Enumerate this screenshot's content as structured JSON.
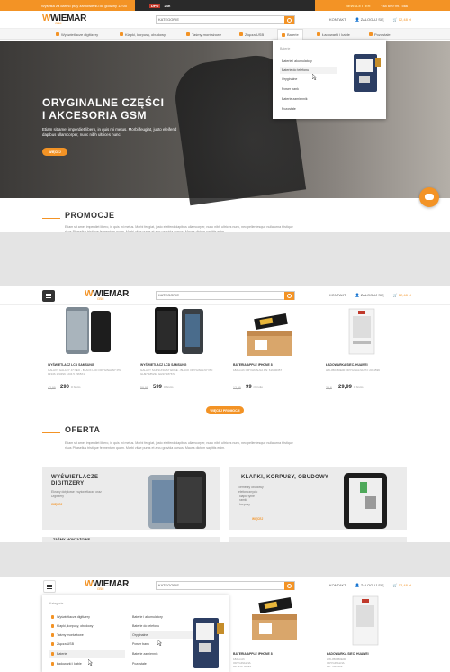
{
  "topbar": {
    "shipping": "Wysyłka za darmo przy zamówieniu do godziny 12:00",
    "delivery_prefix": "DPD",
    "delivery_label": "24h",
    "newsletter": "NEWSLETTER",
    "phone": "+48 609 997 566"
  },
  "header": {
    "logo_main": "WIEMAR",
    "logo_sub": "GSM",
    "search_category": "KATEGORIE",
    "contact": "KONTAKT",
    "login": "ZALOGUJ SIĘ",
    "cart": "12,48 zł"
  },
  "nav": {
    "items": [
      {
        "label": "Wyświetlacze digitizery"
      },
      {
        "label": "Klapki, korpusy, obudowy"
      },
      {
        "label": "Taśmy montażowe"
      },
      {
        "label": "Złącza USB"
      },
      {
        "label": "Baterie"
      },
      {
        "label": "Ładowarki i kable"
      },
      {
        "label": "Pozostałe"
      }
    ]
  },
  "dropdown": {
    "heading": "Baterie",
    "items": [
      "Baterie i akumulatory",
      "Baterie do telefonu",
      "Oryginalne",
      "Power bank",
      "Baterie zamiennik",
      "Pozostałe"
    ]
  },
  "hero": {
    "title_line1": "ORYGINALNE CZĘŚCI",
    "title_line2": "I AKCESORIA GSM",
    "body": "Etiam sit amet imperdiet libero, in quis mi metus. Morbi feugiat, justo eleifend dapibus ullamcorper, nunc nibh ultrices nunc.",
    "button": "WIĘCEJ"
  },
  "promo": {
    "title": "PROMOCJE",
    "body": "Etiam sit amet imperdiet libero, in quis mi metus. Morbi feugiat, justo eleifend dapibus ullamcorper, nunc nibh ultrices nunc, nec pellentesque nulla urna tristique risus Phasellus tristique fermentum quam. Morbi vitae purus et arcu gravida cursus. Mauris dictum sagittis enim."
  },
  "products": [
    {
      "name": "WYŚWIETLACZ LCD SAMSUNG",
      "desc": "GALAXY GALAXY J7 NEO - BLACK LCD ORYGINALNY PN: 1234S 1234S6 1234 5 2365X1",
      "old": "42,99",
      "price": "290",
      "unit": "zł brutto"
    },
    {
      "name": "WYŚWIETLACZ LCD SAMSUNG",
      "desc": "GALAXY SAMSUNG S7 EDGE - BLACK ORYGINALNY PN: GH97-18523A GH97-18767A",
      "old": "59,99",
      "price": "599",
      "unit": "zł brutto"
    },
    {
      "name": "BATERIA APPLE IPHONE 8",
      "desc": "1821mAh ORYGINALNA PN: 616-00357",
      "old": "12,99",
      "price": "99",
      "unit": "zł brutto"
    },
    {
      "name": "ŁADOWARKA SIEC. HUAWEI",
      "desc": "HW-050450E00 ORYGINALNA PN: 2451596",
      "old": "39,6",
      "price": "29,99",
      "unit": "zł brutto"
    }
  ],
  "products_button": "WIĘCEJ PROMOCJI",
  "offer": {
    "title": "OFERTA",
    "body": "Etiam sit amet imperdiet libero, in quis mi metus. Morbi feugiat, justo eleifend dapibus ullamcorper, nunc nibh ultrices nunc, nec pellentesque nulla urna tristique risus Phasellus tristique fermentum quam. Morbi vitae purus et arcu gravida cursus. Mauris dictum sagittis enim.",
    "card1": {
      "title_l1": "WYŚWIETLACZE",
      "title_l2": "DIGITIZERY",
      "desc": "Ekrany dotykowe i wyświetlacze oraz Digitizery",
      "more": "WIĘCEJ"
    },
    "card2": {
      "title": "KLAPKI, KORPUSY, OBUDOWY",
      "desc_l1": "Elementy obudowy",
      "desc_l2": "telefonicznych:",
      "desc_l3": "- klapki tylne",
      "desc_l4": "- ramki",
      "desc_l5": "- korpusy",
      "more": "WIĘCEJ"
    },
    "card3": {
      "title": "TAŚMY MONTAŻOWE"
    }
  },
  "sidemenu": {
    "heading": "Kategorie",
    "items": [
      "Wyświetlacze digitizery",
      "Klapki, korpusy, obudowy",
      "Taśmy montażowe",
      "Złącza USB",
      "Baterie",
      "Ładowarki i kable"
    ],
    "sub": [
      "Baterie i akumulatory",
      "Baterie do telefonu",
      "Oryginalne",
      "Power bank",
      "Baterie zamiennik",
      "Pozostałe"
    ]
  },
  "p3_products": [
    {
      "name": "BATERIA APPLE IPHONE 8",
      "desc1": "1821mAh",
      "desc2": "ORYGINALNA",
      "desc3": "PN: 616-00357"
    },
    {
      "name": "ŁADOWARKA SIEC. HUAWEI",
      "desc1": "HW-050450E00",
      "desc2": "ORYGINALNA",
      "desc3": "PN: 2451596"
    }
  ],
  "colors": {
    "accent": "#f39325",
    "dark": "#2a2a2a"
  }
}
